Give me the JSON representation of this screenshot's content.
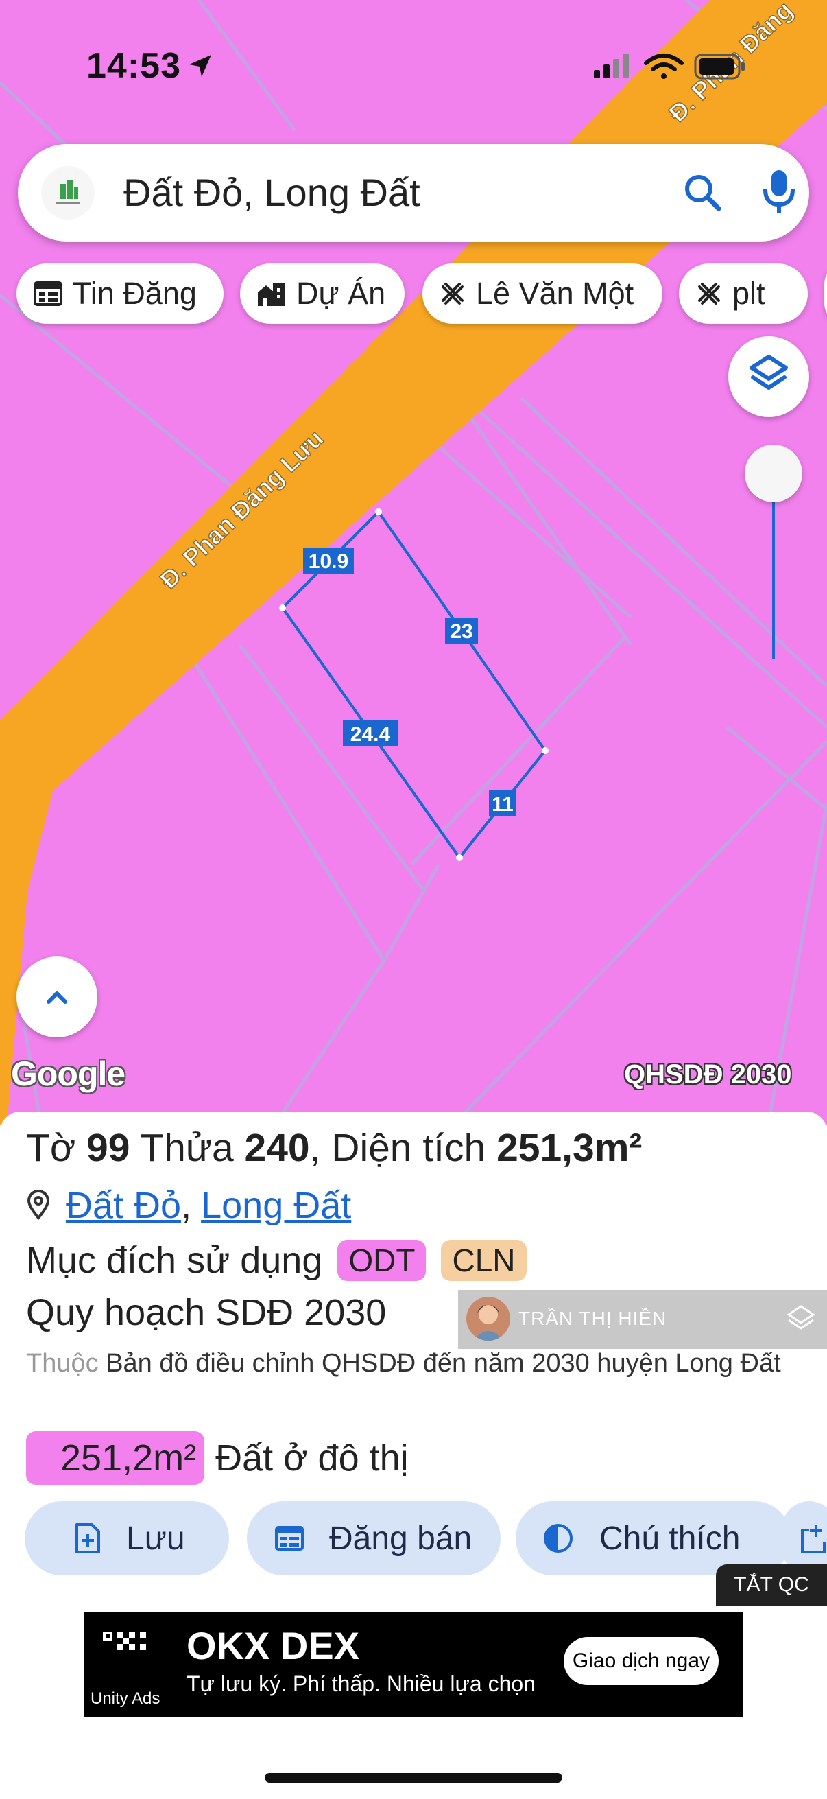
{
  "status_bar": {
    "time": "14:53"
  },
  "search": {
    "query": "Đất Đỏ, Long Đất",
    "icons": [
      "app-logo-icon",
      "search-icon",
      "microphone-icon"
    ]
  },
  "chips": [
    {
      "label": "Tin Đăng",
      "icon": "calendar-list-icon"
    },
    {
      "label": "Dự Án",
      "icon": "buildings-icon"
    },
    {
      "label": "Lê Văn Một",
      "icon": "cross-tools-icon"
    },
    {
      "label": "plt",
      "icon": "cross-tools-icon"
    }
  ],
  "map": {
    "road_labels": [
      "Đ. Phan Đăng Lưu",
      "Đ. Phan Đăng"
    ],
    "parcel_edges": [
      "10.9",
      "23",
      "24.4",
      "11"
    ],
    "logo": "Google",
    "badge": "QHSDĐ 2030",
    "colors": {
      "land": "#f281ee",
      "road": "#f6a623",
      "parcel_line": "#1a67d0"
    }
  },
  "parcel": {
    "title_prefix": "Tờ",
    "sheet": "99",
    "lot_label": "Thửa",
    "lot": "240",
    "area_label": ", Diện tích",
    "area": "251,3m²",
    "address_commune": "Đất Đỏ",
    "address_separator": ",",
    "address_district": "Long Đất",
    "purpose_label": "Mục đích sử dụng",
    "purpose_tags": [
      "ODT",
      "CLN"
    ],
    "planning_label": "Quy hoạch SDĐ 2030",
    "source_prefix": "Thuộc",
    "source_text": "Bản đồ điều chỉnh QHSDĐ đến năm 2030 huyện Long Đất",
    "area_value": "251,2m²",
    "area_type": "Đất ở đô thị"
  },
  "actions": [
    {
      "label": "Lưu",
      "icon": "add-file-icon"
    },
    {
      "label": "Đăng bán",
      "icon": "calendar-list-icon"
    },
    {
      "label": "Chú thích",
      "icon": "contrast-icon"
    }
  ],
  "overlay": {
    "name": "TRẦN THỊ HIỀN"
  },
  "ad": {
    "close_label": "TẮT QC",
    "brand": "OKX DEX",
    "tagline": "Tự lưu ký. Phí thấp. Nhiều lựa chọn",
    "cta": "Giao dịch ngay",
    "provider": "Unity Ads"
  }
}
